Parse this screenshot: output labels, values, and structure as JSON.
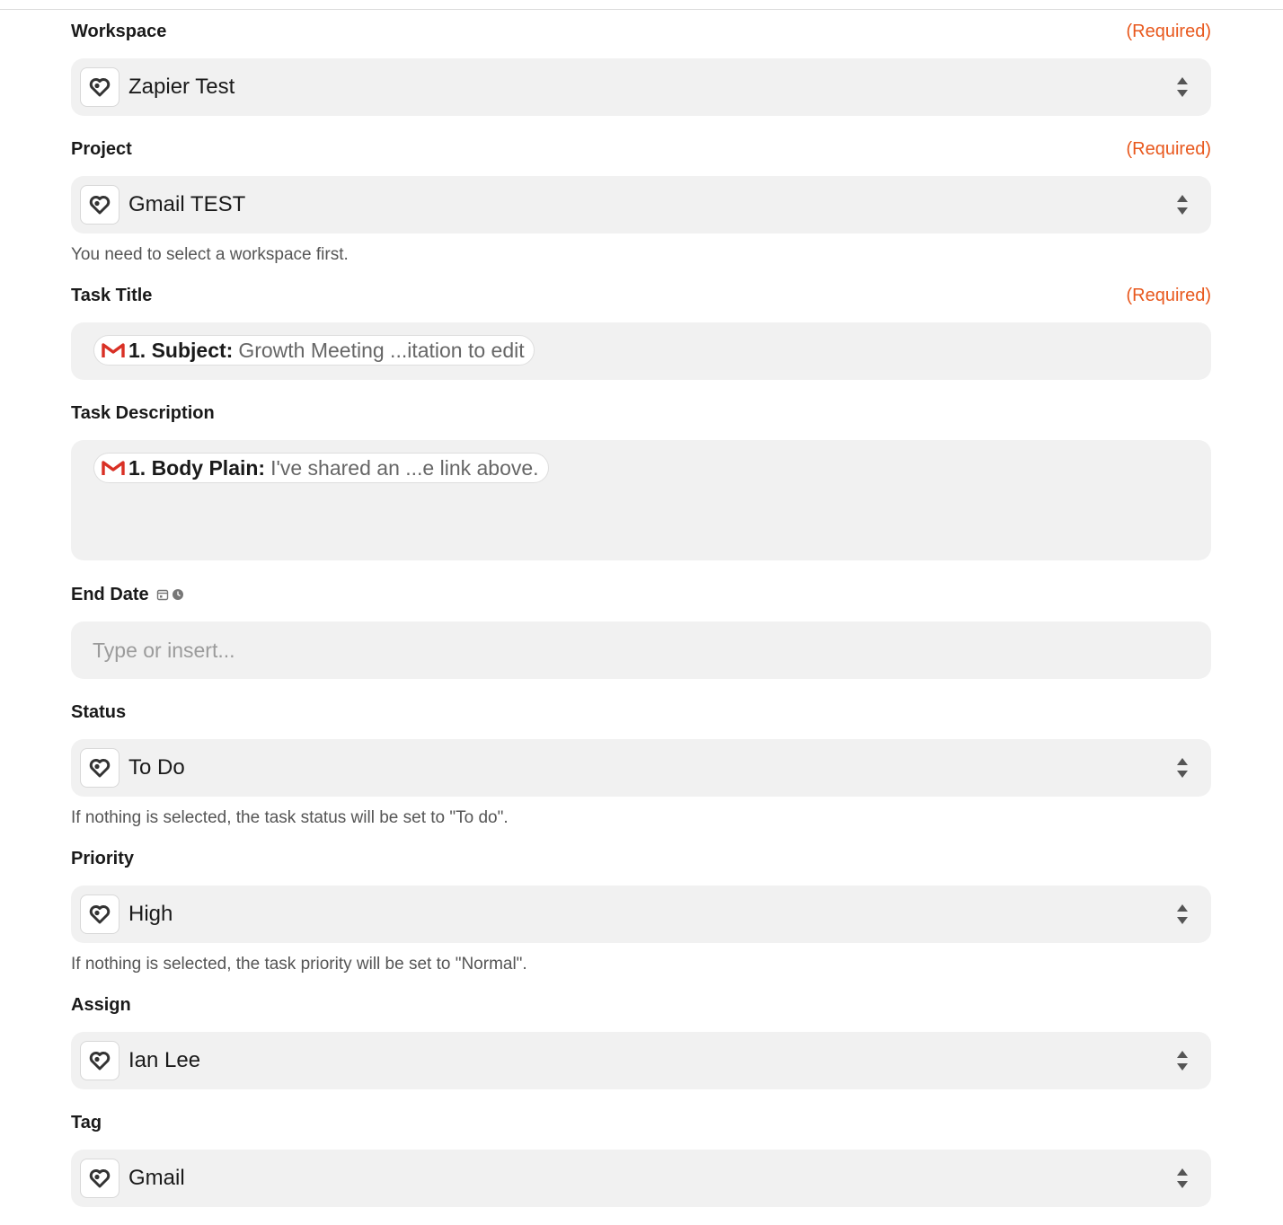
{
  "required_text": "(Required)",
  "fields": {
    "workspace": {
      "label": "Workspace",
      "value": "Zapier Test"
    },
    "project": {
      "label": "Project",
      "value": "Gmail TEST",
      "help": "You need to select a workspace first."
    },
    "task_title": {
      "label": "Task Title",
      "pill_key": "1. Subject:",
      "pill_value": "Growth Meeting ...itation to edit"
    },
    "task_description": {
      "label": "Task Description",
      "pill_key": "1. Body Plain:",
      "pill_value": "I've shared an ...e link above."
    },
    "end_date": {
      "label": "End Date",
      "placeholder": "Type or insert..."
    },
    "status": {
      "label": "Status",
      "value": "To Do",
      "help": "If nothing is selected, the task status will be set to \"To do\"."
    },
    "priority": {
      "label": "Priority",
      "value": "High",
      "help": "If nothing is selected, the task priority will be set to \"Normal\"."
    },
    "assign": {
      "label": "Assign",
      "value": "Ian Lee"
    },
    "tag": {
      "label": "Tag",
      "value": "Gmail"
    }
  },
  "colors": {
    "required": "#e8581d",
    "field_bg": "#f1f1f1",
    "gmail_red": "#d93025"
  },
  "icons": {
    "app": "clickup-heart-icon",
    "gmail": "gmail-icon",
    "sort": "sort-arrows-icon",
    "calendar": "calendar-icon",
    "clock": "clock-icon"
  }
}
